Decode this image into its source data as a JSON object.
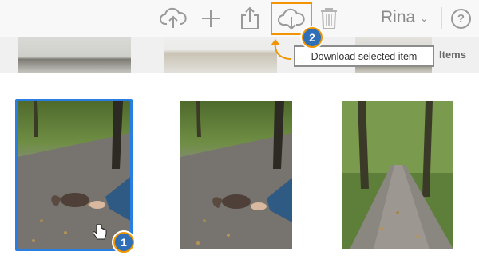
{
  "toolbar": {
    "upload_icon": "cloud-upload-icon",
    "add_icon": "plus-icon",
    "share_icon": "share-icon",
    "download_icon": "cloud-download-icon",
    "delete_icon": "trash-icon",
    "user_name": "Rina",
    "user_menu_icon": "chevron-down-icon",
    "help_label": "?"
  },
  "tooltip": {
    "text": "Download selected item"
  },
  "items_label": "Items",
  "badges": {
    "step1": "1",
    "step2": "2"
  },
  "colors": {
    "highlight": "#f29400",
    "selection": "#2a7de1",
    "badge": "#2f6fb8"
  },
  "photos": [
    {
      "name": "squirrel-photo-1",
      "selected": true
    },
    {
      "name": "squirrel-photo-2",
      "selected": false
    },
    {
      "name": "forest-path-photo",
      "selected": false
    }
  ]
}
